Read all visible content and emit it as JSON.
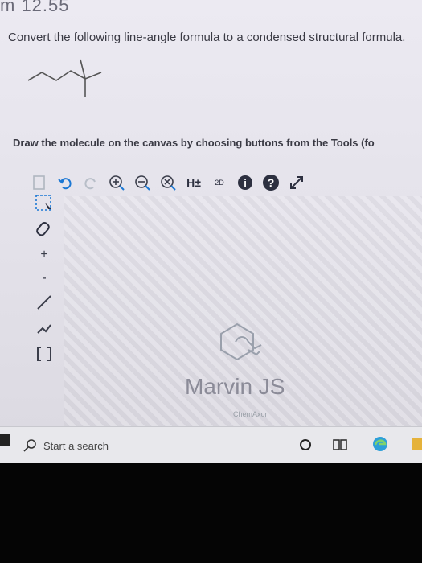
{
  "page": {
    "header_fragment": "m 12.55",
    "question": "Convert the following line-angle formula to a condensed structural formula.",
    "instruction": "Draw the molecule on the canvas by choosing buttons from the Tools (fo"
  },
  "editor": {
    "toolbar": [
      {
        "name": "new-doc-icon",
        "glyph": "🗋"
      },
      {
        "name": "undo-icon",
        "glyph": "↶"
      },
      {
        "name": "redo-icon",
        "glyph": "↷"
      },
      {
        "name": "zoom-in-icon",
        "glyph": "⊕"
      },
      {
        "name": "zoom-out-icon",
        "glyph": "⊖"
      },
      {
        "name": "zoom-fit-icon",
        "glyph": "⊗"
      },
      {
        "name": "hydrogen-icon",
        "glyph": "H±"
      },
      {
        "name": "2d-clean-icon",
        "glyph": "2D"
      },
      {
        "name": "info-icon",
        "glyph": "i"
      },
      {
        "name": "help-icon",
        "glyph": "?"
      },
      {
        "name": "fullscreen-icon",
        "glyph": "⤢"
      }
    ],
    "hydrogen_label": "H±",
    "clean_label": "2D",
    "brand": "Marvin JS",
    "vendor": "ChemAxon"
  },
  "taskbar": {
    "search_placeholder": "Start a search"
  },
  "colors": {
    "accent_blue": "#1c78d4",
    "info_dark": "#2d3040",
    "edge_logo": "#2d9fd8"
  }
}
